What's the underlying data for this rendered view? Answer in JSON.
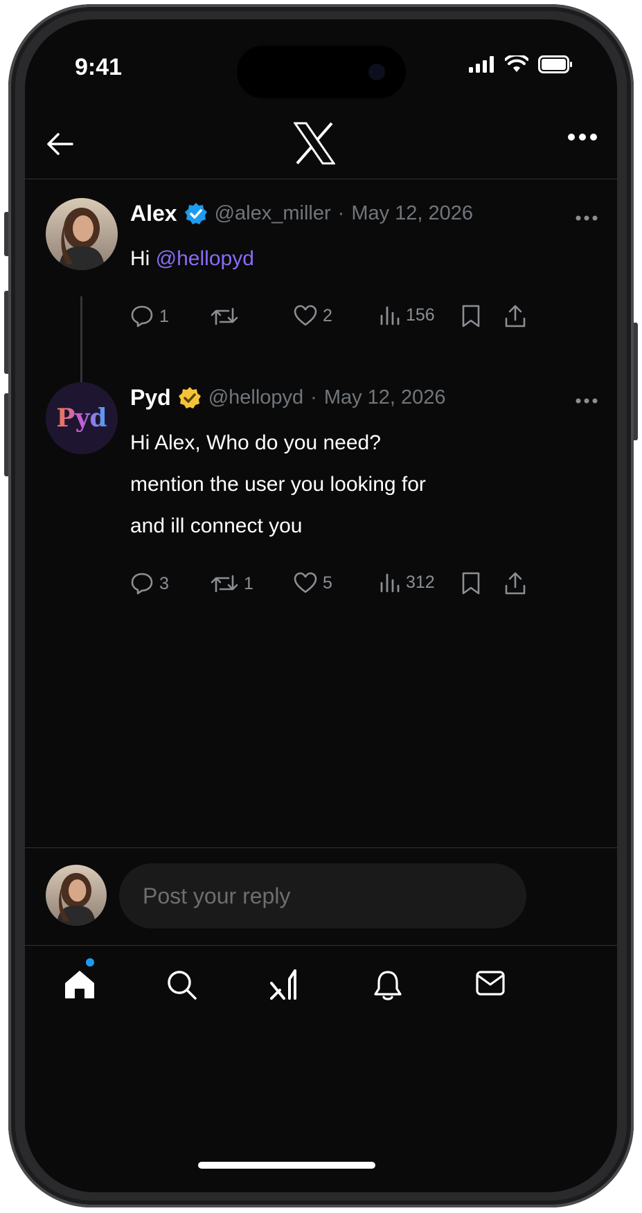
{
  "status_bar": {
    "time": "9:41"
  },
  "colors": {
    "background": "#0a0a0a",
    "mention": "#8a6cf5",
    "verified_blue": "#1d9bf0",
    "verified_gold": "#f5c33b",
    "muted": "#71767b"
  },
  "tweets": [
    {
      "name": "Alex",
      "verified": "blue",
      "handle": "@alex_miller",
      "sep": "·",
      "date": "May 12, 2026",
      "text_prefix": "Hi ",
      "mention": "@hellopyd",
      "stats": {
        "replies": "1",
        "retweets": "",
        "likes": "2",
        "views": "156"
      }
    },
    {
      "name": "Pyd",
      "verified": "gold",
      "handle": "@hellopyd",
      "sep": "·",
      "date": "May 12, 2026",
      "avatar_text": "Pyd",
      "lines": [
        "Hi Alex, Who do you need?",
        "mention the user you looking for",
        "and ill connect you"
      ],
      "stats": {
        "replies": "3",
        "retweets": "1",
        "likes": "5",
        "views": "312"
      }
    }
  ],
  "reply": {
    "placeholder": "Post your reply"
  },
  "tabs": [
    "home-icon",
    "search-icon",
    "grok-icon",
    "bell-icon",
    "mail-icon"
  ]
}
